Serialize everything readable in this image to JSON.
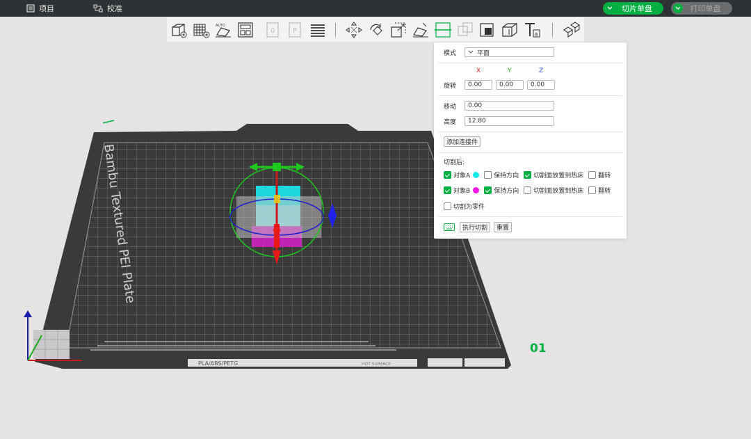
{
  "topbar": {
    "project_label": "项目",
    "calibrate_label": "校准",
    "slice_label": "切片单盘",
    "print_label": "打印单盘",
    "accent": "#00ae42"
  },
  "toolbar": {
    "tools": [
      "add-cube-icon",
      "arrange-grid-icon",
      "auto-orient-icon",
      "layout-icon",
      "plate-0-icon",
      "plate-p-icon",
      "layers-icon",
      "move-icon",
      "rotate-icon",
      "scale-icon",
      "lay-on-face-icon",
      "cut-icon",
      "boolean-icon",
      "support-paint-icon",
      "seam-paint-icon",
      "text-icon",
      "assembly-icon"
    ],
    "active_tool": "cut-icon"
  },
  "scene": {
    "plate_name": "Bambu Textured PEI Plate",
    "plate_number": "01",
    "filament_text": "PLA/ABS/PETG",
    "hot_surface_text": "HOT SURFACE"
  },
  "cut_panel": {
    "mode_label": "模式",
    "mode_value": "平面",
    "axis_x": "X",
    "axis_y": "Y",
    "axis_z": "Z",
    "rotation_label": "旋转",
    "rotation": {
      "x": "0.00",
      "y": "0.00",
      "z": "0.00"
    },
    "move_label": "移动",
    "move_value": "0.00",
    "height_label": "高度",
    "height_value": "12.80",
    "add_connector_label": "添加连接件",
    "after_cut_label": "切割后:",
    "object_a": {
      "label": "对象A",
      "color": "#18e8f0",
      "keep_orientation_label": "保持方向",
      "keep_orientation": false,
      "place_on_bed_label": "切割面放置到热床",
      "place_on_bed": true,
      "flip_label": "翻转",
      "flip": false,
      "enabled": true
    },
    "object_b": {
      "label": "对象B",
      "color": "#ff19e8",
      "keep_orientation_label": "保持方向",
      "keep_orientation": true,
      "place_on_bed_label": "切割面放置到热床",
      "place_on_bed": false,
      "flip_label": "翻转",
      "flip": false,
      "enabled": true
    },
    "cut_to_parts_label": "切割为零件",
    "cut_to_parts": false,
    "perform_cut_label": "执行切割",
    "reset_label": "重置"
  }
}
